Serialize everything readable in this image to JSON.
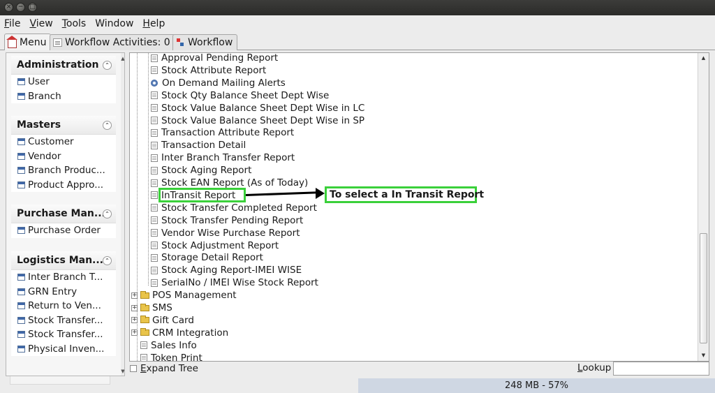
{
  "window": {
    "buttons": [
      "×",
      "−",
      "□"
    ]
  },
  "menubar": {
    "items": [
      {
        "label": "File",
        "mnemonic": "F",
        "rest": "ile"
      },
      {
        "label": "View",
        "mnemonic": "V",
        "rest": "iew"
      },
      {
        "label": "Tools",
        "mnemonic": "T",
        "rest": "ools"
      },
      {
        "label": "Window",
        "mnemonic": "",
        "rest": "Window"
      },
      {
        "label": "Help",
        "mnemonic": "H",
        "rest": "elp"
      }
    ]
  },
  "tabs": [
    {
      "label": "Menu",
      "icon": "house-icon",
      "active": true
    },
    {
      "label": "Workflow Activities: 0",
      "icon": "clipboard-icon",
      "active": false
    },
    {
      "label": "Workflow",
      "icon": "workflow-icon",
      "active": false
    }
  ],
  "sidebar": {
    "sections": [
      {
        "title": "Administration",
        "items": [
          "User",
          "Branch"
        ]
      },
      {
        "title": "Masters",
        "items": [
          "Customer",
          "Vendor",
          "Branch Produc...",
          "Product Appro..."
        ]
      },
      {
        "title": "Purchase Man...",
        "items": [
          "Purchase Order"
        ]
      },
      {
        "title": "Logistics Man...",
        "items": [
          "Inter Branch T...",
          "GRN Entry",
          "Return to Ven...",
          "Stock Transfer...",
          "Stock Transfer...",
          "Physical Inven..."
        ]
      }
    ]
  },
  "tree": {
    "report_items": [
      {
        "label": "Approval Pending Report",
        "icon": "document-icon"
      },
      {
        "label": "Stock Attribute Report",
        "icon": "document-icon"
      },
      {
        "label": "On Demand Mailing Alerts",
        "icon": "gear-icon"
      },
      {
        "label": "Stock Qty Balance Sheet Dept Wise",
        "icon": "document-icon"
      },
      {
        "label": "Stock Value Balance Sheet Dept Wise in LC",
        "icon": "document-icon"
      },
      {
        "label": "Stock Value Balance Sheet Dept Wise in SP",
        "icon": "document-icon"
      },
      {
        "label": "Transaction Attribute Report",
        "icon": "document-icon"
      },
      {
        "label": "Transaction Detail",
        "icon": "document-icon"
      },
      {
        "label": "Inter Branch Transfer Report",
        "icon": "document-icon"
      },
      {
        "label": "Stock Aging Report",
        "icon": "document-icon"
      },
      {
        "label": "Stock EAN Report (As of Today)",
        "icon": "document-icon"
      },
      {
        "label": "InTransit Report",
        "icon": "document-icon",
        "highlighted": true
      },
      {
        "label": "Stock Transfer Completed Report",
        "icon": "document-icon"
      },
      {
        "label": "Stock Transfer Pending Report",
        "icon": "document-icon"
      },
      {
        "label": "Vendor Wise Purchase Report",
        "icon": "document-icon"
      },
      {
        "label": "Stock Adjustment Report",
        "icon": "document-icon"
      },
      {
        "label": "Storage Detail Report",
        "icon": "document-icon"
      },
      {
        "label": "Stock Aging Report-IMEI WISE",
        "icon": "document-icon"
      },
      {
        "label": "SerialNo / IMEI Wise Stock Report",
        "icon": "document-icon"
      }
    ],
    "folders": [
      {
        "label": "POS Management"
      },
      {
        "label": "SMS"
      },
      {
        "label": "Gift Card"
      },
      {
        "label": "CRM Integration"
      }
    ],
    "leaf_items": [
      {
        "label": "Sales Info"
      },
      {
        "label": "Token Print"
      }
    ]
  },
  "annotation": {
    "callout_text": "To select a In Transit Report",
    "highlight_color": "#3ad03a"
  },
  "bottombar": {
    "expand_tree_label": "Expand Tree",
    "expand_tree_checked": false,
    "lookup_label": "Lookup",
    "lookup_value": ""
  },
  "status": {
    "memory_text": "248 MB - 57%"
  }
}
